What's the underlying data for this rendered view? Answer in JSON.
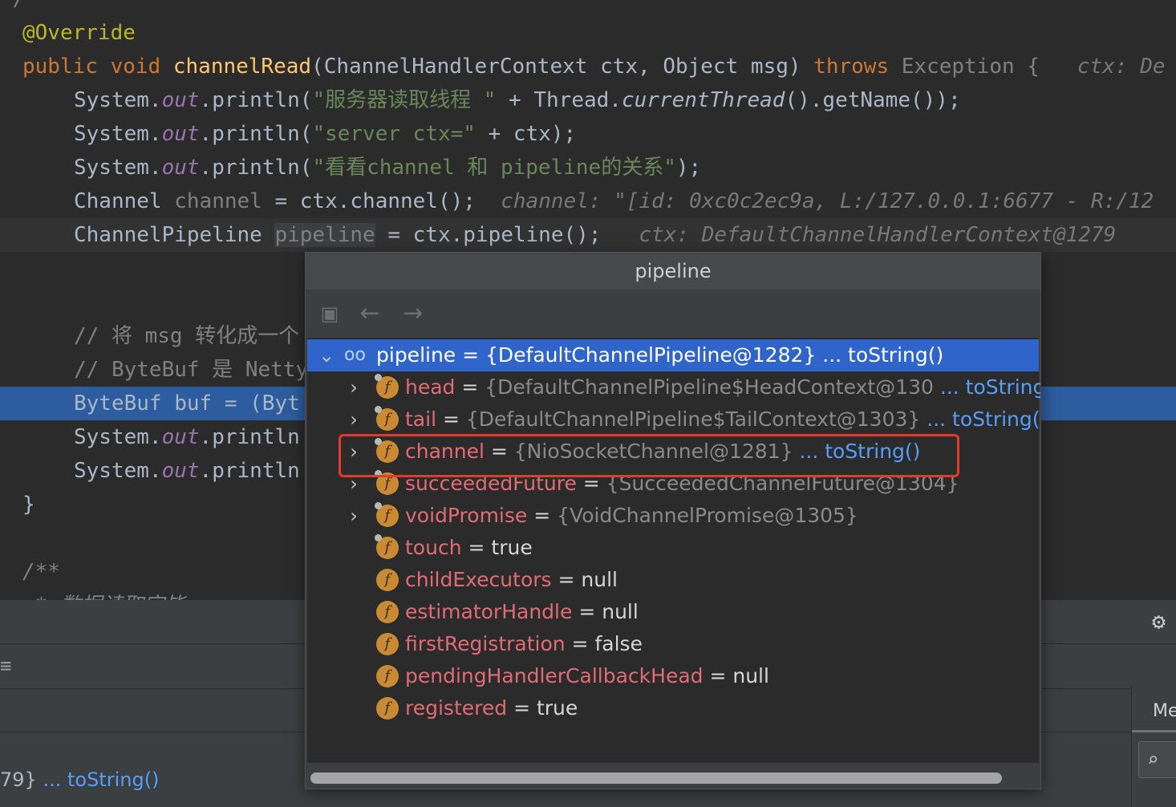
{
  "editor": {
    "line_partial_top": "*/",
    "annotation": "@Override",
    "decl": {
      "kw_public": "public",
      "kw_void": "void",
      "method": "channelRead",
      "params": "(ChannelHandlerContext ctx, Object msg)",
      "kw_throws": "throws",
      "exception": "Exception {",
      "hint": "ctx: De"
    },
    "l1": {
      "pre": "System.",
      "out": "out",
      "mid": ".println(",
      "str": "\"服务器读取线程 \"",
      "plus": " + Thread.",
      "ct": "currentThread",
      "tail": "().getName());"
    },
    "l2": {
      "pre": "System.",
      "out": "out",
      "mid": ".println(",
      "str": "\"server ctx=\"",
      "tail": " + ctx);"
    },
    "l3": {
      "pre": "System.",
      "out": "out",
      "mid": ".println(",
      "str": "\"看看channel 和 pipeline的关系\"",
      "tail": ");"
    },
    "l4": {
      "type": "Channel ",
      "var": "channel",
      "rest": " = ctx.channel();",
      "hint": "channel: \"[id: 0xc0c2ec9a, L:/127.0.0.1:6677 - R:/12"
    },
    "l5": {
      "type": "ChannelPipeline ",
      "var": "pipeline",
      "rest": " = ctx.pipeline();",
      "hint": "ctx: DefaultChannelHandlerContext@1279"
    },
    "c1": "// 将 msg 转化成一个",
    "c2": "// ByteBuf 是 Netty",
    "l6": "ByteBuf buf = (Byt",
    "l7": {
      "pre": "System.",
      "out": "out",
      "mid": ".println"
    },
    "l8": {
      "pre": "System.",
      "out": "out",
      "mid": ".println"
    },
    "close": "}",
    "javadoc": "/**",
    "javadoc2": " * 数据读取完毕"
  },
  "bottom": {
    "text_prefix": "79}",
    "text_link": "... toString()",
    "right_tab": "Me"
  },
  "popup": {
    "title": "pipeline",
    "root": {
      "name": "pipeline",
      "value": " = {DefaultChannelPipeline@1282}",
      "link": " ... toString()"
    },
    "rows": [
      {
        "name": "head",
        "value": "{DefaultChannelPipeline$HeadContext@130",
        "link": "... toString()",
        "expandable": true,
        "marked": true
      },
      {
        "name": "tail",
        "value": "{DefaultChannelPipeline$TailContext@1303}",
        "link": " ... toString()",
        "expandable": true,
        "marked": true
      },
      {
        "name": "channel",
        "value": "{NioSocketChannel@1281}",
        "link": " ... toString()",
        "expandable": true,
        "marked": true
      },
      {
        "name": "succeededFuture",
        "value": "{SucceededChannelFuture@1304}",
        "link": "",
        "expandable": true,
        "marked": true
      },
      {
        "name": "voidPromise",
        "value": "{VoidChannelPromise@1305}",
        "link": "",
        "expandable": true,
        "marked": true
      },
      {
        "name": "touch",
        "value": "true",
        "link": "",
        "expandable": false,
        "marked": true
      },
      {
        "name": "childExecutors",
        "value": "null",
        "link": "",
        "expandable": false,
        "marked": false
      },
      {
        "name": "estimatorHandle",
        "value": "null",
        "link": "",
        "expandable": false,
        "marked": false
      },
      {
        "name": "firstRegistration",
        "value": "false",
        "link": "",
        "expandable": false,
        "marked": false
      },
      {
        "name": "pendingHandlerCallbackHead",
        "value": "null",
        "link": "",
        "expandable": false,
        "marked": false
      },
      {
        "name": "registered",
        "value": "true",
        "link": "",
        "expandable": false,
        "marked": false
      }
    ]
  },
  "colors": {
    "highlight_box": "#e23a2b",
    "selection": "#2f65ca",
    "field_name": "#e06c75"
  }
}
